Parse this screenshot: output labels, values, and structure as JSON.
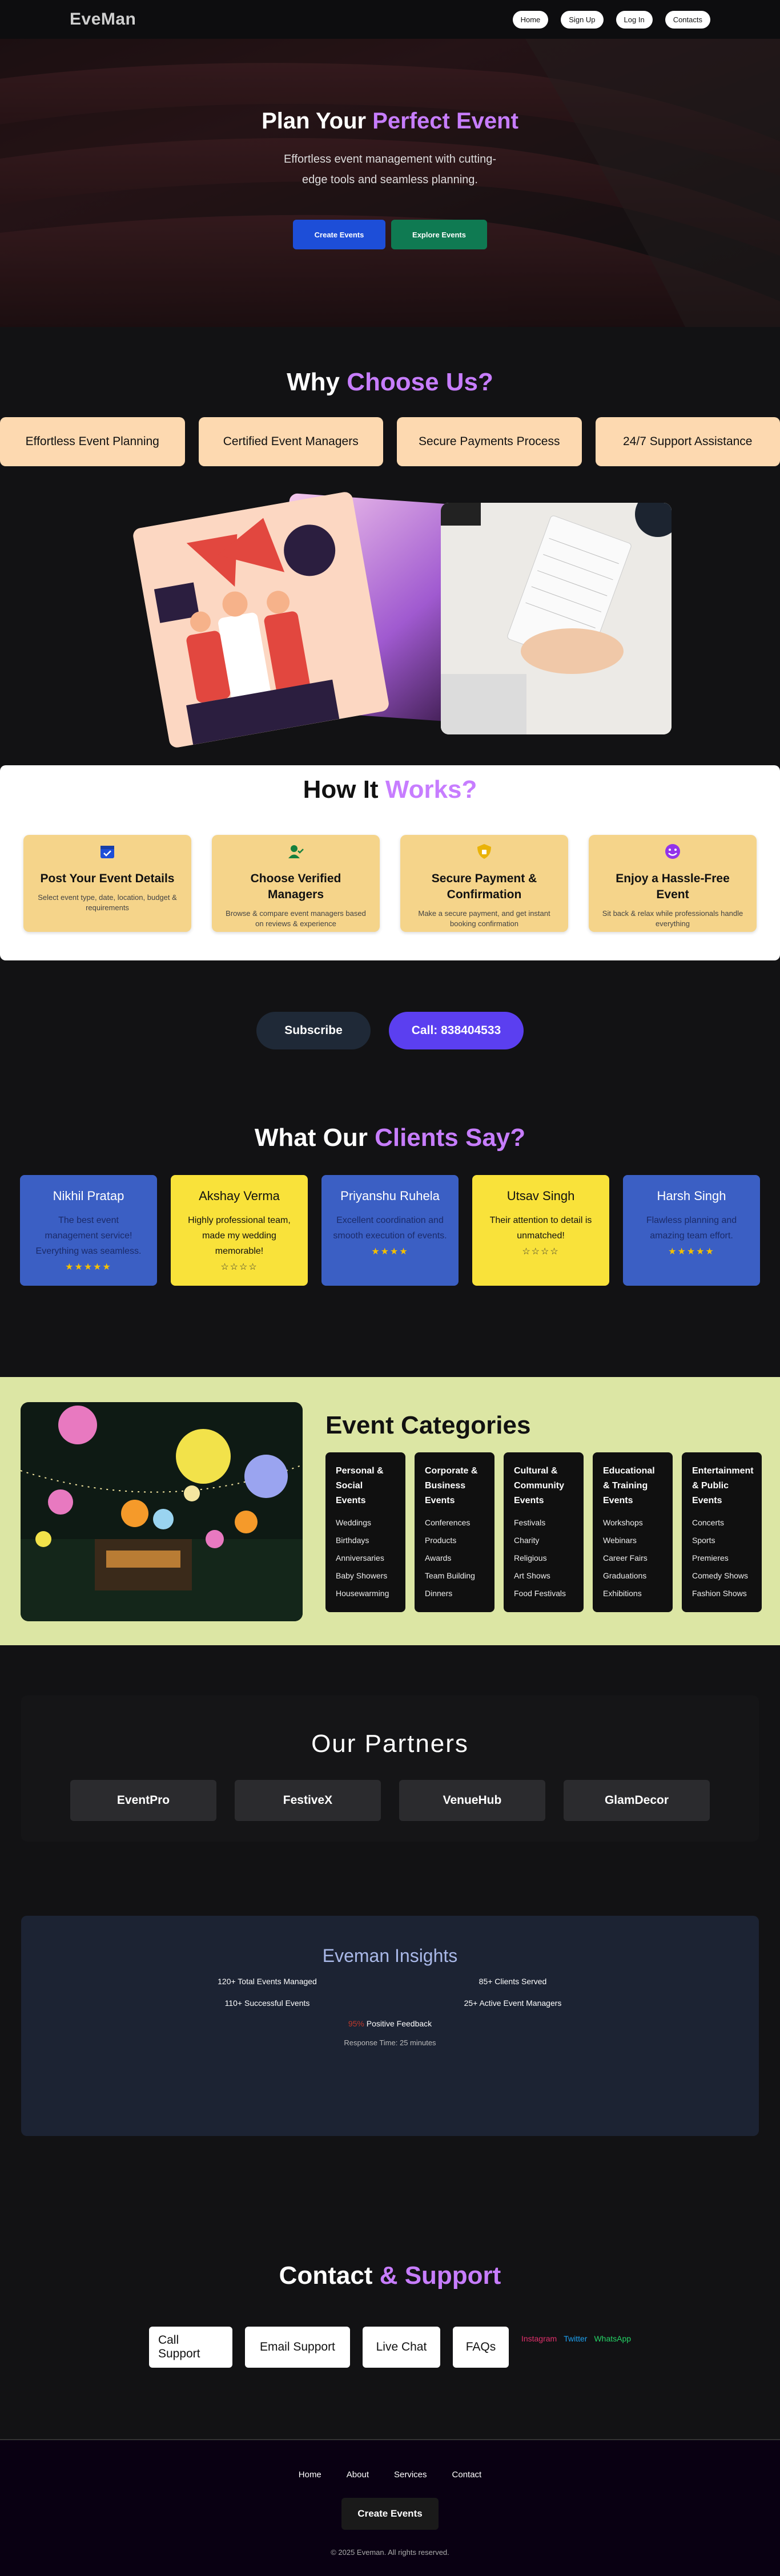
{
  "brand": {
    "logo": "EveMan"
  },
  "nav": {
    "items": [
      "Home",
      "Sign Up",
      "Log In",
      "Contacts"
    ]
  },
  "hero": {
    "title_plain": "Plan Your",
    "title_accent": "Perfect Event",
    "subtitle": "Effortless event management with cutting-edge tools and seamless planning.",
    "btn_create": "Create Events",
    "btn_explore": "Explore Events"
  },
  "why": {
    "title_plain": "Why",
    "title_accent": "Choose Us?",
    "cards": [
      "Effortless Event Planning",
      "Certified Event Managers",
      "Secure Payments Process",
      "24/7 Support Assistance"
    ]
  },
  "how": {
    "title_plain": "How It",
    "title_accent": "Works?",
    "steps": [
      {
        "title": "Post Your Event Details",
        "desc": "Select event type, date, location, budget & requirements",
        "icon": "calendar-check-icon"
      },
      {
        "title": "Choose Verified Managers",
        "desc": "Browse & compare event managers based on reviews & experience",
        "icon": "user-check-icon"
      },
      {
        "title": "Secure Payment & Confirmation",
        "desc": "Make a secure payment, and get instant booking confirmation",
        "icon": "shield-icon"
      },
      {
        "title": "Enjoy a Hassle-Free Event",
        "desc": "Sit back & relax while professionals handle everything",
        "icon": "smile-icon"
      }
    ]
  },
  "cta": {
    "subscribe": "Subscribe",
    "call": "Call: 838404533"
  },
  "clients": {
    "title_plain": "What Our",
    "title_accent": "Clients Say?",
    "items": [
      {
        "name": "Nikhil Pratap",
        "text": "The best event management service! Everything was seamless.",
        "stars": "★★★★★",
        "color": "blue"
      },
      {
        "name": "Akshay Verma",
        "text": "Highly professional team, made my wedding memorable!",
        "stars": "☆☆☆☆",
        "color": "yellow"
      },
      {
        "name": "Priyanshu Ruhela",
        "text": "Excellent coordination and smooth execution of events.",
        "stars": "★★★★",
        "color": "blue"
      },
      {
        "name": "Utsav Singh",
        "text": "Their attention to detail is unmatched!",
        "stars": "☆☆☆☆",
        "color": "yellow"
      },
      {
        "name": "Harsh Singh",
        "text": "Flawless planning and amazing team effort.",
        "stars": "★★★★★",
        "color": "blue"
      }
    ]
  },
  "categories": {
    "title": "Event Categories",
    "cols": [
      {
        "title": "Personal & Social Events",
        "items": [
          "Weddings",
          "Birthdays",
          "Anniversaries",
          "Baby Showers",
          "Housewarming"
        ]
      },
      {
        "title": "Corporate & Business Events",
        "items": [
          "Conferences",
          "Products",
          "Awards",
          "Team Building",
          "Dinners"
        ]
      },
      {
        "title": "Cultural & Community Events",
        "items": [
          "Festivals",
          "Charity",
          "Religious",
          "Art Shows",
          "Food Festivals"
        ]
      },
      {
        "title": "Educational & Training Events",
        "items": [
          "Workshops",
          "Webinars",
          "Career Fairs",
          "Graduations",
          "Exhibitions"
        ]
      },
      {
        "title": "Entertainment & Public Events",
        "items": [
          "Concerts",
          "Sports",
          "Premieres",
          "Comedy Shows",
          "Fashion Shows"
        ]
      }
    ]
  },
  "partners": {
    "title": "Our Partners",
    "items": [
      "EventPro",
      "FestiveX",
      "VenueHub",
      "GlamDecor"
    ]
  },
  "insights": {
    "title": "Eveman Insights",
    "stats": [
      "120+ Total Events Managed",
      "85+ Clients Served",
      "110+ Successful Events",
      "25+ Active Event Managers"
    ],
    "feedback_pct": "95%",
    "feedback_label": "Positive Feedback",
    "response": "Response Time: 25 minutes"
  },
  "contact": {
    "title_plain": "Contact",
    "title_accent": "& Support",
    "buttons": [
      "Call Support",
      "Email Support",
      "Live Chat",
      "FAQs"
    ],
    "socials": [
      {
        "label": "Instagram",
        "color": "#e1306c"
      },
      {
        "label": "Twitter",
        "color": "#1da1f2"
      },
      {
        "label": "WhatsApp",
        "color": "#25d366"
      }
    ]
  },
  "footer": {
    "links": [
      "Home",
      "About",
      "Services",
      "Contact"
    ],
    "button": "Create Events",
    "copyright": "© 2025 Eveman. All rights reserved."
  }
}
